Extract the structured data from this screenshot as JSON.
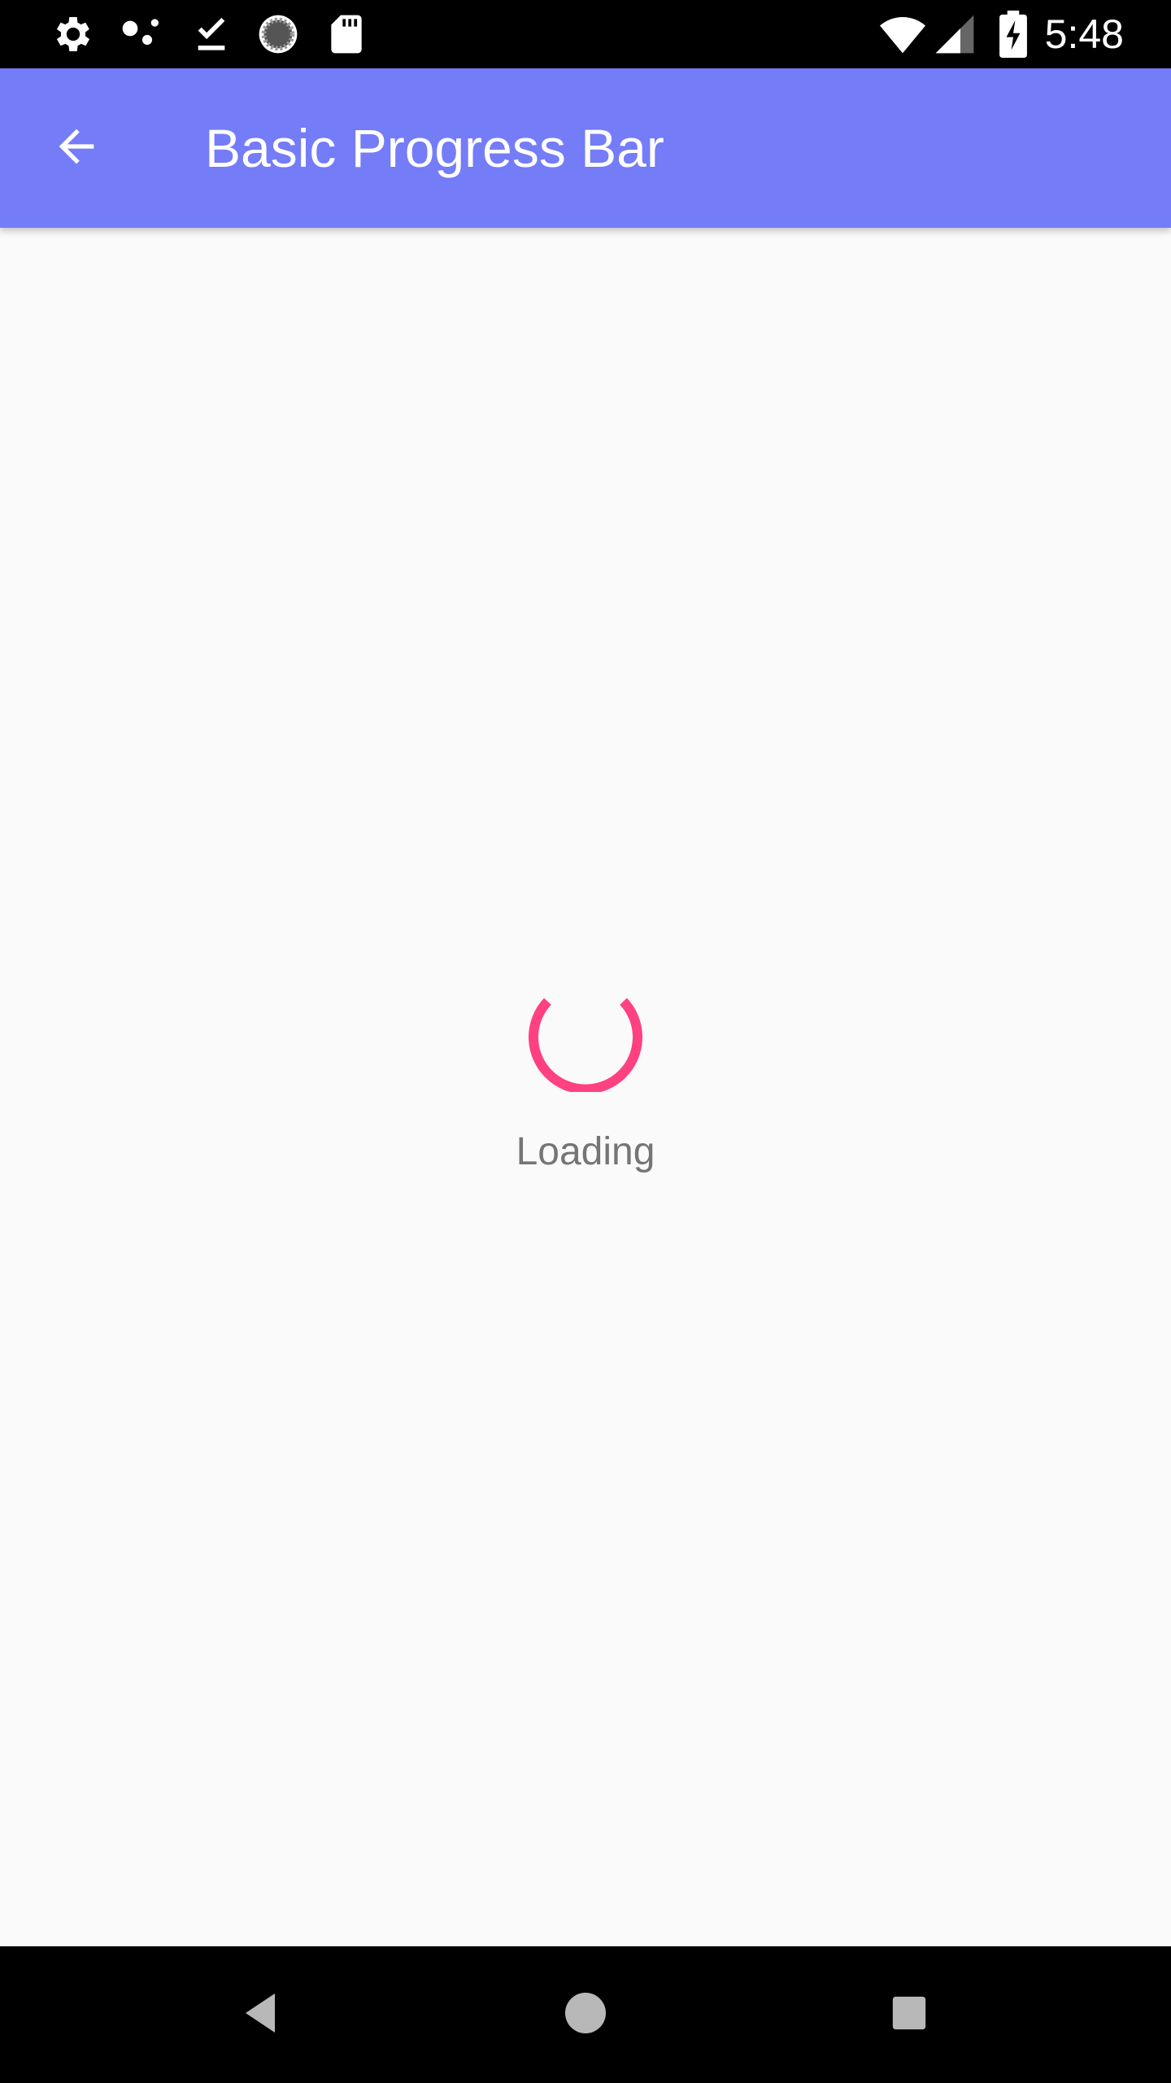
{
  "status_bar": {
    "time": "5:48",
    "icons": [
      "settings-icon",
      "connection-dots-icon",
      "download-done-icon",
      "sync-circle-icon",
      "sd-card-icon",
      "wifi-icon",
      "cell-signal-icon",
      "battery-charging-icon"
    ]
  },
  "app_bar": {
    "title": "Basic Progress Bar",
    "back_icon": "arrow-back-icon",
    "background_color": "#747cf8"
  },
  "content": {
    "loading_label": "Loading",
    "spinner_color": "#ff4081"
  },
  "nav_bar": {
    "buttons": [
      "back-triangle-icon",
      "home-circle-icon",
      "recents-square-icon"
    ]
  }
}
